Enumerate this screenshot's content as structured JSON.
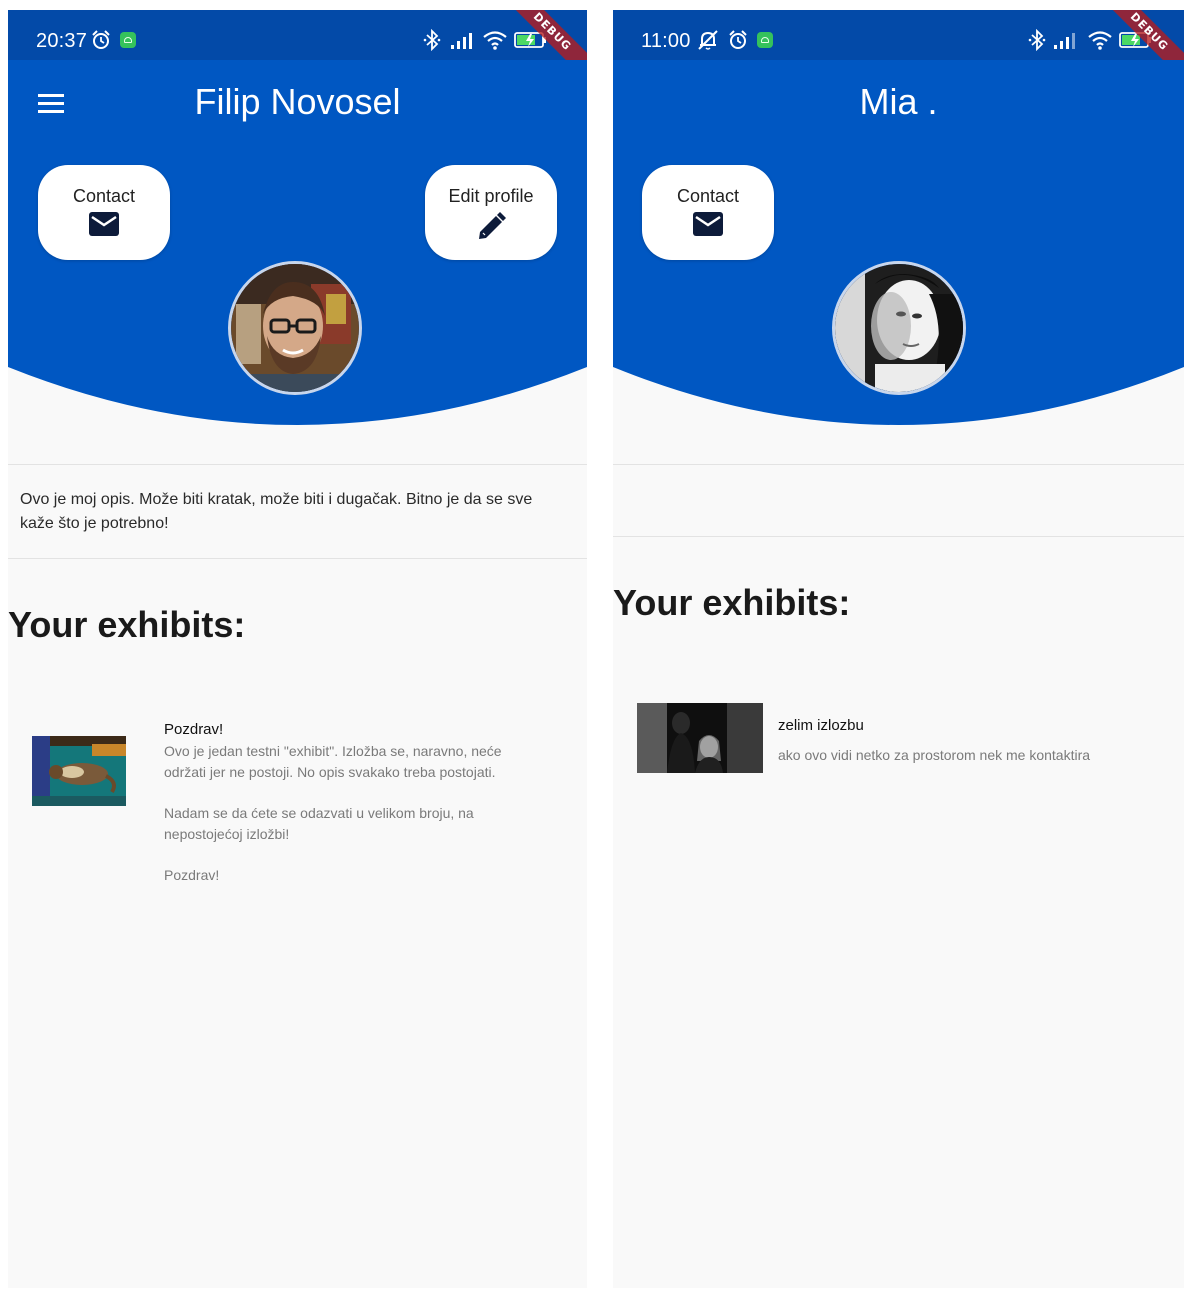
{
  "colors": {
    "status_bar": "#034aa8",
    "header": "#0057c2",
    "card": "#ffffff",
    "background": "#f9f9f9",
    "android_badge": "#35c25c"
  },
  "left": {
    "status": {
      "time": "20:37",
      "icons": [
        "alarm-icon",
        "android-badge-icon",
        "bluetooth-icon",
        "signal-icon",
        "wifi-icon",
        "battery-charging-icon"
      ],
      "debug_label": "DEBUG"
    },
    "header": {
      "menu_icon": "hamburger-menu-icon",
      "title": "Filip Novosel"
    },
    "actions": {
      "contact_label": "Contact",
      "contact_icon": "mail-icon",
      "edit_label": "Edit profile",
      "edit_icon": "pencil-icon"
    },
    "bio": "Ovo je moj opis. Može biti kratak, može biti i dugačak. Bitno je da se sve kaže što je potrebno!",
    "section_title": "Your exhibits:",
    "exhibit": {
      "title": "Pozdrav!",
      "desc": [
        "Ovo je jedan testni \"exhibit\". Izložba se, naravno, neće održati jer ne postoji. No opis svakako treba postojati.",
        "Nadam se da ćete se odazvati u velikom broju, na nepostojećoj izložbi!",
        "Pozdrav!"
      ]
    }
  },
  "right": {
    "status": {
      "time": "11:00",
      "icons": [
        "muted-bell-icon",
        "alarm-icon",
        "android-badge-icon",
        "bluetooth-icon",
        "signal-icon",
        "wifi-icon",
        "battery-charging-icon"
      ],
      "debug_label": "DEBUG"
    },
    "header": {
      "title": "Mia ."
    },
    "actions": {
      "contact_label": "Contact",
      "contact_icon": "mail-icon"
    },
    "section_title": "Your exhibits:",
    "exhibit": {
      "title": "zelim izlozbu",
      "desc": "ako ovo vidi netko za prostorom nek me kontaktira"
    }
  }
}
